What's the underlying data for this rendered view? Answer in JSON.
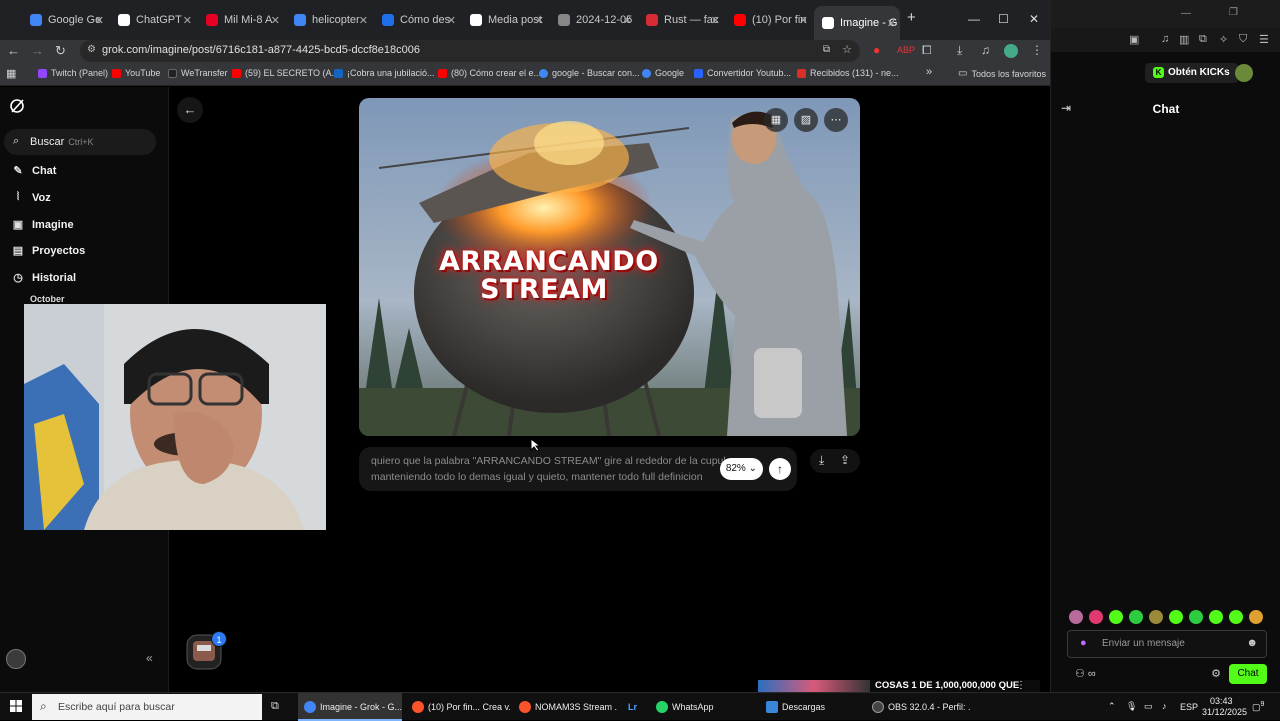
{
  "browser": {
    "tabs": [
      {
        "label": "Google Ge",
        "color": "#4285f4"
      },
      {
        "label": "ChatGPT",
        "color": "#ffffff"
      },
      {
        "label": "Mil Mi-8 A",
        "color": "#e60023"
      },
      {
        "label": "helicopter",
        "color": "#4285f4"
      },
      {
        "label": "Cómo des",
        "color": "#1f6feb"
      },
      {
        "label": "Media post",
        "color": "#ffffff"
      },
      {
        "label": "2024-12-05",
        "color": "#888888"
      },
      {
        "label": "Rust — fac",
        "color": "#d82c35"
      },
      {
        "label": "(10) Por fin",
        "color": "#ff0000"
      },
      {
        "label": "Imagine - G",
        "color": "#ffffff"
      }
    ],
    "url": "grok.com/imagine/post/6716c181-a877-4425-bcd5-dccf8e18c006",
    "bookmarks": [
      {
        "label": "Twitch (Panel)",
        "color": "#9146ff"
      },
      {
        "label": "YouTube",
        "color": "#ff0000"
      },
      {
        "label": "WeTransfer",
        "color": "#222222"
      },
      {
        "label": "(59) EL SECRETO (A...",
        "color": "#ff0000"
      },
      {
        "label": "¡Cobra una jubilació...",
        "color": "#1565c0"
      },
      {
        "label": "(80) Cómo crear el e...",
        "color": "#ff0000"
      },
      {
        "label": "google - Buscar con...",
        "color": "#4285f4"
      },
      {
        "label": "Google",
        "color": "#4285f4"
      },
      {
        "label": "Convertidor Youtub...",
        "color": "#2962ff"
      },
      {
        "label": "Recibidos (131) - ne...",
        "color": "#d93025"
      }
    ],
    "more_bookmarks": "»",
    "all_bookmarks": "Todos los favoritos"
  },
  "sidebar": {
    "search_label": "Buscar",
    "search_shortcut": "Ctrl+K",
    "items": [
      {
        "label": "Chat"
      },
      {
        "label": "Voz"
      },
      {
        "label": "Imagine"
      },
      {
        "label": "Proyectos"
      },
      {
        "label": "Historial"
      }
    ],
    "history_group": "October",
    "collapse": "«"
  },
  "post": {
    "image_title_line1": "ARRANCANDO",
    "image_title_line2": "STREAM",
    "prompt_line1": "quiero que la palabra \"ARRANCANDO STREAM\" gire al rededor de la cupula",
    "prompt_line2": "manteniendo todo lo demas igual y quieto,  mantener todo full definicion",
    "ratio_label": "82%",
    "notification_count": "1"
  },
  "chat_panel": {
    "kicks_label": "Obtén KICKs",
    "title": "Chat",
    "input_placeholder": "Enviar un mensaje",
    "send_label": "Chat",
    "emote_colors": [
      "#b86a9b",
      "#e03a70",
      "#53fc18",
      "#2ecc40",
      "#9a8a3a",
      "#53fc18",
      "#2ecc40",
      "#53fc18",
      "#53fc18",
      "#e0a030"
    ]
  },
  "overlay": {
    "banner_text": "COSAS 1 DE 1,000,000,000 QUE"
  },
  "taskbar": {
    "search_placeholder": "Escribe aquí para buscar",
    "items": [
      {
        "label": "Imagine - Grok - G...",
        "color": "#4285f4"
      },
      {
        "label": "(10) Por fin... Crea v...",
        "color": "#fb542b"
      },
      {
        "label": "NOMAM3S Stream ...",
        "color": "#fb542b"
      },
      {
        "label": "",
        "color": "#001e36"
      },
      {
        "label": "WhatsApp",
        "color": "#25d366"
      },
      {
        "label": "Descargas",
        "color": "#3a86d8"
      },
      {
        "label": "OBS 32.0.4 - Perfil: ...",
        "color": "#444444"
      }
    ],
    "lightroom_label": "Lr",
    "language": "ESP",
    "time": "03:43",
    "date": "31/12/2025",
    "notification_count": "9"
  }
}
